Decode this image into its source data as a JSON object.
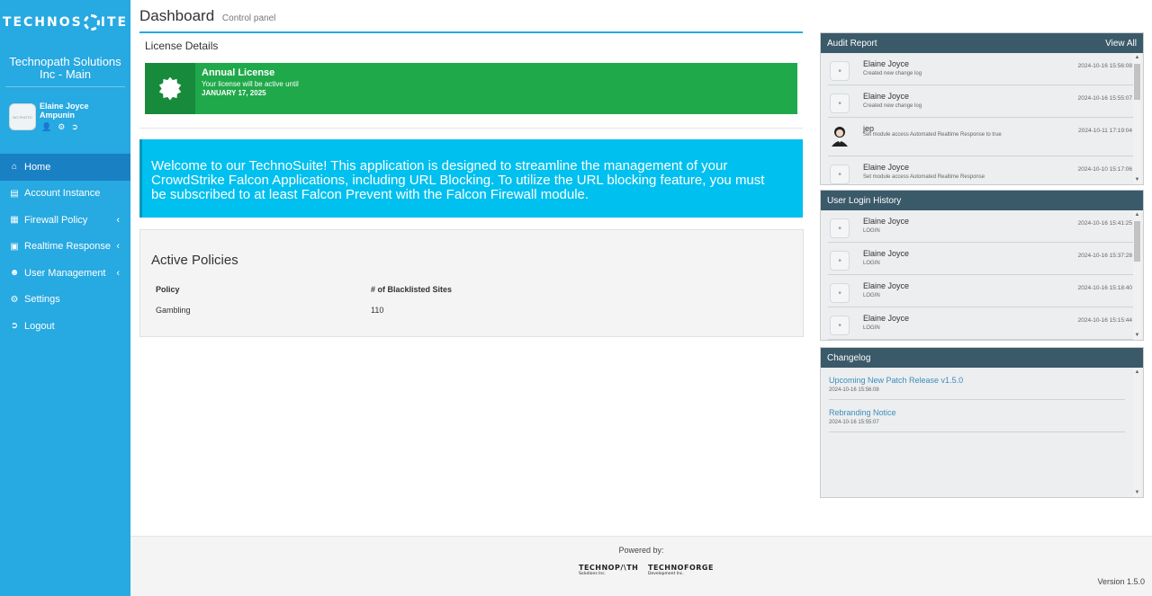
{
  "brand": {
    "name_left": "TECHNOS",
    "name_right": "ITE"
  },
  "org": {
    "name": "Technopath Solutions Inc - Main"
  },
  "user": {
    "name": "Elaine Joyce Ampunin",
    "avatar_text": "NO PHOTO"
  },
  "nav": [
    {
      "label": "Home",
      "icon": "home-icon",
      "active": true
    },
    {
      "label": "Account Instance",
      "icon": "building-icon"
    },
    {
      "label": "Firewall Policy",
      "icon": "firewall-icon"
    },
    {
      "label": "Realtime Response",
      "icon": "terminal-icon"
    },
    {
      "label": "User Management",
      "icon": "users-icon"
    },
    {
      "label": "Settings",
      "icon": "gear-icon"
    },
    {
      "label": "Logout",
      "icon": "logout-icon"
    }
  ],
  "header": {
    "title": "Dashboard",
    "subtitle": "Control panel"
  },
  "license": {
    "section_title": "License Details",
    "title": "Annual License",
    "text": "Your license will be active until",
    "date": "JANUARY 17, 2025"
  },
  "welcome": {
    "text": "Welcome to our TechnoSuite! This application is designed to streamline the management of your CrowdStrike Falcon Applications, including URL Blocking. To utilize the URL blocking feature, you must be subscribed to at least Falcon Prevent with the Falcon Firewall module."
  },
  "policies": {
    "title": "Active Policies",
    "columns": [
      "Policy",
      "# of Blacklisted Sites"
    ],
    "rows": [
      [
        "Gambling",
        "110"
      ]
    ]
  },
  "audit": {
    "title": "Audit Report",
    "view_all": "View All",
    "entries": [
      {
        "name": "Elaine Joyce",
        "desc": "Created new change log",
        "time": "2024-10-16 15:56:08"
      },
      {
        "name": "Elaine Joyce",
        "desc": "Created new change log",
        "time": "2024-10-16 15:55:07"
      },
      {
        "name": "jep",
        "desc": "Set module access Automated Realtime Response to true",
        "time": "2024-10-11 17:19:04"
      },
      {
        "name": "Elaine Joyce",
        "desc": "Set module access Automated Realtime Response",
        "time": "2024-10-10 15:17:06"
      }
    ]
  },
  "login_history": {
    "title": "User Login History",
    "entries": [
      {
        "name": "Elaine Joyce",
        "desc": "LOGIN",
        "time": "2024-10-16 15:41:25"
      },
      {
        "name": "Elaine Joyce",
        "desc": "LOGIN",
        "time": "2024-10-16 15:37:28"
      },
      {
        "name": "Elaine Joyce",
        "desc": "LOGIN",
        "time": "2024-10-16 15:18:40"
      },
      {
        "name": "Elaine Joyce",
        "desc": "LOGIN",
        "time": "2024-10-16 15:15:44"
      }
    ]
  },
  "changelog": {
    "title": "Changelog",
    "entries": [
      {
        "title": "Upcoming New Patch Release v1.5.0",
        "date": "2024-10-16 15:56:08"
      },
      {
        "title": "Rebranding Notice",
        "date": "2024-10-16 15:55:07"
      }
    ]
  },
  "footer": {
    "powered_by": "Powered by:",
    "logo1": "TECHNOP/\\TH",
    "logo1_sub": "Solutions Inc.",
    "logo2": "TECHNOFORGE",
    "logo2_sub": "Development Inc.",
    "version": "Version 1.5.0"
  },
  "colors": {
    "sidebar": "#27a9e1",
    "active_nav": "#1a80c4",
    "license_green": "#20a94a",
    "welcome_cyan": "#00c0ef",
    "panel_header": "#3b5a69",
    "link_blue": "#3c8dbc"
  }
}
